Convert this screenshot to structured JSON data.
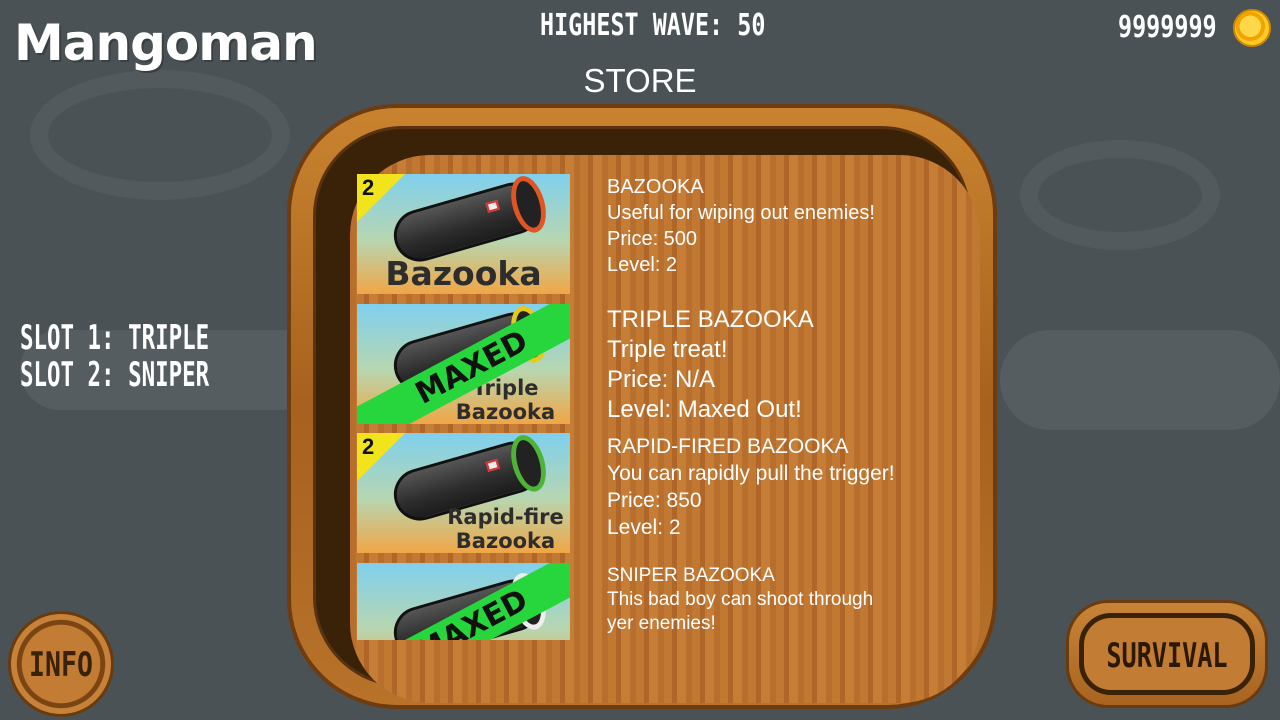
{
  "hud": {
    "logo": "Mangoman",
    "highest_wave": "HIGHEST WAVE: 50",
    "coins": "9999999",
    "store_title": "STORE"
  },
  "slots": {
    "slot1": "SLOT 1: TRIPLE",
    "slot2": "SLOT 2: SNIPER"
  },
  "items": [
    {
      "thumb_title": "Bazooka",
      "badge": "2",
      "ring_color": "#e05524",
      "name": "BAZOOKA",
      "desc": "Useful for wiping out enemies!",
      "price": "Price: 500",
      "level": "Level: 2"
    },
    {
      "thumb_title_1": "Triple",
      "thumb_title_2": "Bazooka",
      "maxed": "MAXED",
      "ring_color": "#e8c81c",
      "name": "TRIPLE BAZOOKA",
      "desc": "Triple treat!",
      "price": "Price: N/A",
      "level": "Level: Maxed Out!"
    },
    {
      "thumb_title_1": "Rapid-fire",
      "thumb_title_2": "Bazooka",
      "badge": "2",
      "ring_color": "#4fb33a",
      "name": "RAPID-FIRED BAZOOKA",
      "desc": "You can rapidly pull the trigger!",
      "price": "Price: 850",
      "level": "Level: 2"
    },
    {
      "maxed": "MAXED",
      "ring_color": "#eeeeee",
      "name": "SNIPER BAZOOKA",
      "desc_1": "This bad boy can shoot through",
      "desc_2": "yer enemies!"
    }
  ],
  "buttons": {
    "info": "INFO",
    "survival": "SURVIVAL"
  }
}
